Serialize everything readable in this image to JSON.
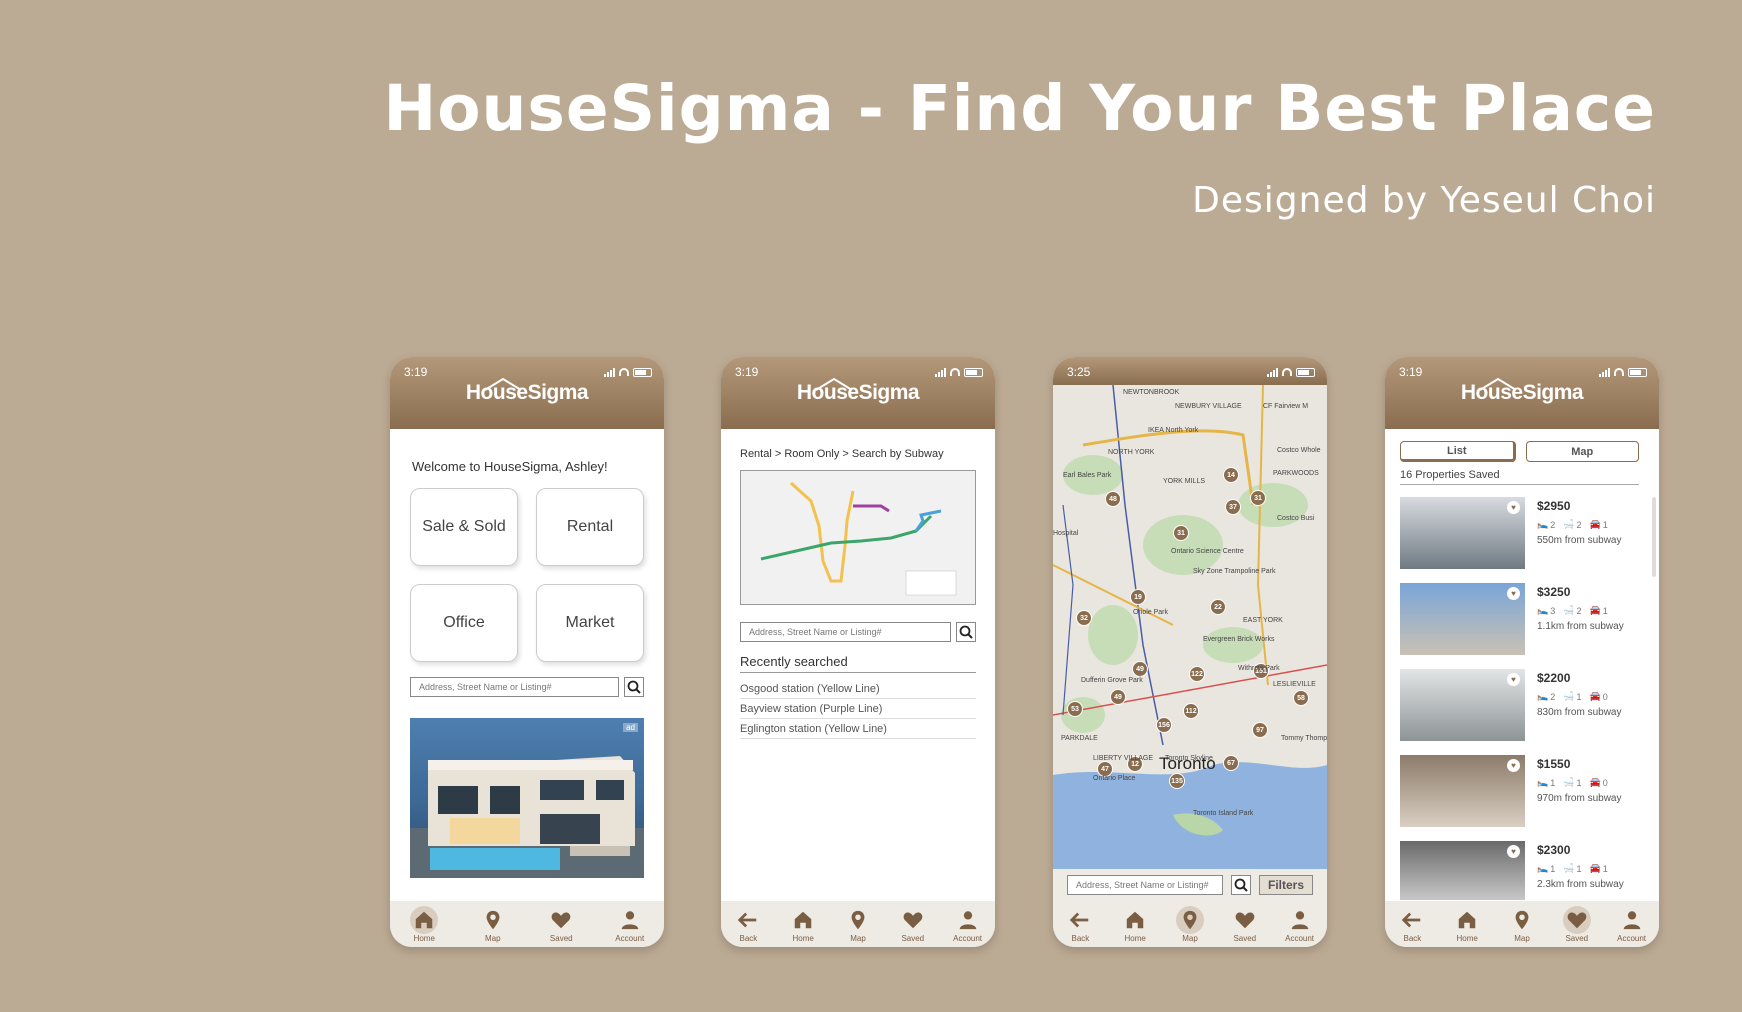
{
  "header": {
    "title": "HouseSigma - Find Your Best Place",
    "subtitle": "Designed by Yeseul Choi"
  },
  "brand": {
    "logo_text": "HouseSigma",
    "color_dark": "#8a6d4f",
    "color_light": "#b4987a",
    "background": "#bcab94"
  },
  "nav_labels": {
    "back": "Back",
    "home": "Home",
    "map": "Map",
    "saved": "Saved",
    "account": "Account"
  },
  "search_placeholder": "Address, Street Name or Listing#",
  "phone1": {
    "time": "3:19",
    "welcome": "Welcome to HouseSigma, Ashley!",
    "tiles": [
      "Sale & Sold",
      "Rental",
      "Office",
      "Market"
    ],
    "ad_tag": "ad"
  },
  "phone2": {
    "time": "3:19",
    "breadcrumb": "Rental > Room Only > Search by Subway",
    "recent_title": "Recently searched",
    "recent": [
      "Osgood station (Yellow Line)",
      "Bayview station (Purple Line)",
      "Eglington station (Yellow Line)"
    ]
  },
  "phone3": {
    "time": "3:25",
    "city": "Toronto",
    "filters_label": "Filters",
    "pins": [
      "14",
      "37",
      "31",
      "48",
      "31",
      "19",
      "22",
      "32",
      "49",
      "151",
      "122",
      "49",
      "112",
      "58",
      "53",
      "156",
      "97",
      "47",
      "12",
      "67",
      "135"
    ],
    "map_labels": [
      "NEWTONBROOK",
      "NEWBURY VILLAGE",
      "IKEA North York",
      "NORTH YORK",
      "CF Fairview M",
      "Costco Whole",
      "Earl Bales Park",
      "YORK MILLS",
      "PARKWOODS",
      "Costco Busi",
      "Ontario Science Centre",
      "Sky Zone Trampoline Park",
      "Oriole Park",
      "EAST YORK",
      "Evergreen Brick Works",
      "Withrow Park",
      "LESLIEVILLE",
      "Dufferin Grove Park",
      "PARKDALE",
      "LIBERTY VILLAGE",
      "Toronto Skyline",
      "Ontario Place",
      "Toronto Island Park",
      "Hospital",
      "Tommy Thompson Park"
    ]
  },
  "phone4": {
    "time": "3:19",
    "tab_list": "List",
    "tab_map": "Map",
    "count": "16 Properties Saved",
    "properties": [
      {
        "price": "$2950",
        "beds": "2",
        "baths": "2",
        "parking": "1",
        "distance": "550m from subway"
      },
      {
        "price": "$3250",
        "beds": "3",
        "baths": "2",
        "parking": "1",
        "distance": "1.1km from subway"
      },
      {
        "price": "$2200",
        "beds": "2",
        "baths": "1",
        "parking": "0",
        "distance": "830m from subway"
      },
      {
        "price": "$1550",
        "beds": "1",
        "baths": "1",
        "parking": "0",
        "distance": "970m from subway"
      },
      {
        "price": "$2300",
        "beds": "1",
        "baths": "1",
        "parking": "1",
        "distance": "2.3km from subway"
      }
    ]
  }
}
